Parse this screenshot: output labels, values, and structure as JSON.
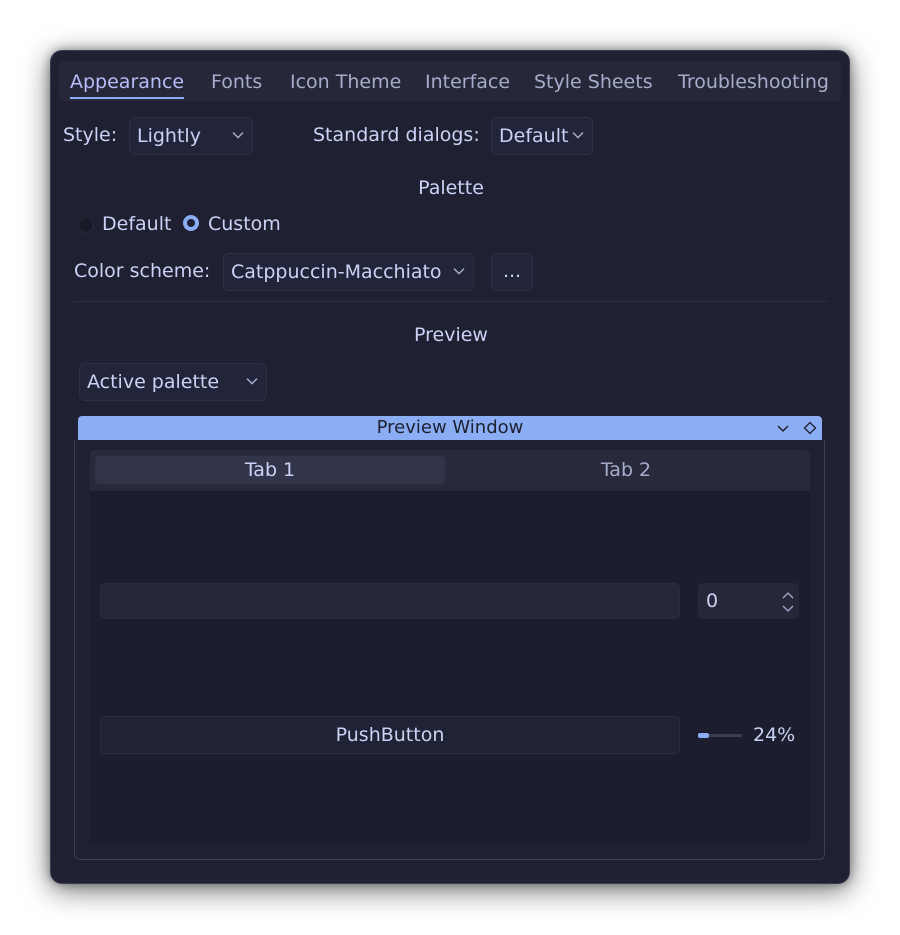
{
  "tabs": [
    {
      "label": "Appearance",
      "active": true
    },
    {
      "label": "Fonts"
    },
    {
      "label": "Icon Theme"
    },
    {
      "label": "Interface"
    },
    {
      "label": "Style Sheets"
    },
    {
      "label": "Troubleshooting"
    }
  ],
  "style": {
    "label": "Style:",
    "value": "Lightly"
  },
  "dialogs": {
    "label": "Standard dialogs:",
    "value": "Default"
  },
  "palette": {
    "heading": "Palette",
    "options": [
      {
        "label": "Default",
        "checked": false
      },
      {
        "label": "Custom",
        "checked": true
      }
    ],
    "color_scheme_label": "Color scheme:",
    "color_scheme_value": "Catppuccin-Macchiato",
    "more_button": "..."
  },
  "preview": {
    "heading": "Preview",
    "palette_select": "Active palette",
    "window_title": "Preview Window",
    "tab1": "Tab 1",
    "tab2": "Tab 2",
    "spin_value": "0",
    "push_button": "PushButton",
    "progress_percent": 24,
    "progress_label": "24%"
  },
  "colors": {
    "accent": "#8aadf4",
    "background": "#1f2133",
    "text": "#cad3f5"
  }
}
